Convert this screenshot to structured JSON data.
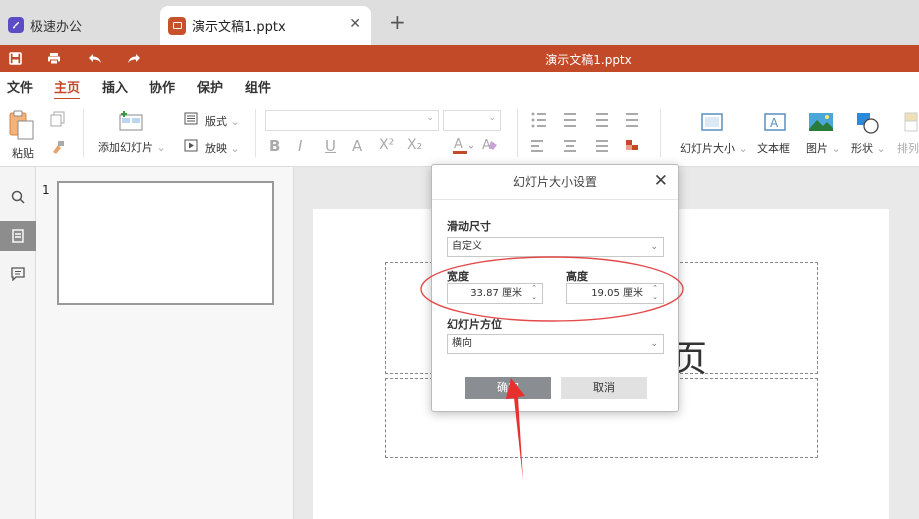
{
  "tabs": {
    "app_name": "极速办公",
    "doc_tab": "演示文稿1.pptx",
    "close": "✕",
    "new_tab": "+"
  },
  "titlebar": {
    "title": "演示文稿1.pptx"
  },
  "menu": {
    "items": [
      "文件",
      "主页",
      "插入",
      "协作",
      "保护",
      "组件"
    ],
    "active": "主页"
  },
  "ribbon": {
    "paste": "粘贴",
    "add_slide": "添加幻灯片",
    "layout": "版式",
    "play": "放映",
    "slide_size": "幻灯片大小",
    "textbox": "文本框",
    "picture": "图片",
    "shape": "形状",
    "arrange": "排列",
    "font_buttons": [
      "B",
      "I",
      "U",
      "A",
      "X²",
      "X₂"
    ]
  },
  "thumbs": {
    "number": "1"
  },
  "slide": {
    "partial_char": "页"
  },
  "dialog": {
    "title": "幻灯片大小设置",
    "close": "✕",
    "size_label": "滑动尺寸",
    "size_value": "自定义",
    "width_label": "宽度",
    "width_value": "33.87 厘米",
    "height_label": "高度",
    "height_value": "19.05 厘米",
    "orientation_label": "幻灯片方位",
    "orientation_value": "横向",
    "ok": "确定",
    "cancel": "取消"
  },
  "colors": {
    "accent": "#c34a28",
    "highlight": "#e34a4a"
  }
}
